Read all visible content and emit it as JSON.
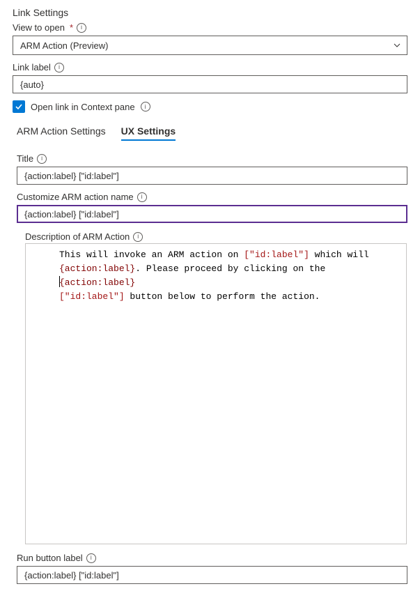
{
  "section_title": "Link Settings",
  "view_to_open": {
    "label": "View to open",
    "value": "ARM Action (Preview)"
  },
  "link_label": {
    "label": "Link label",
    "value": "{auto}"
  },
  "open_in_context": {
    "label": "Open link in Context pane",
    "checked": true
  },
  "tabs": {
    "arm": "ARM Action Settings",
    "ux": "UX Settings"
  },
  "title_field": {
    "label": "Title",
    "value": "{action:label} [\"id:label\"]"
  },
  "customize_arm": {
    "label": "Customize ARM action name",
    "value": "{action:label} [\"id:label\"]"
  },
  "description": {
    "label": "Description of ARM Action",
    "segments": {
      "s1": "This will invoke an ARM action on ",
      "s2": "[\"id:label\"]",
      "s3": " which will ",
      "s4": "{action:label}",
      "s5": ". Please proceed by clicking on the ",
      "s6": "{action:label}",
      "s7": " ",
      "s8": "[\"id:label\"]",
      "s9": " button below to perform the action."
    }
  },
  "run_button": {
    "label": "Run button label",
    "value": "{action:label} [\"id:label\"]"
  }
}
